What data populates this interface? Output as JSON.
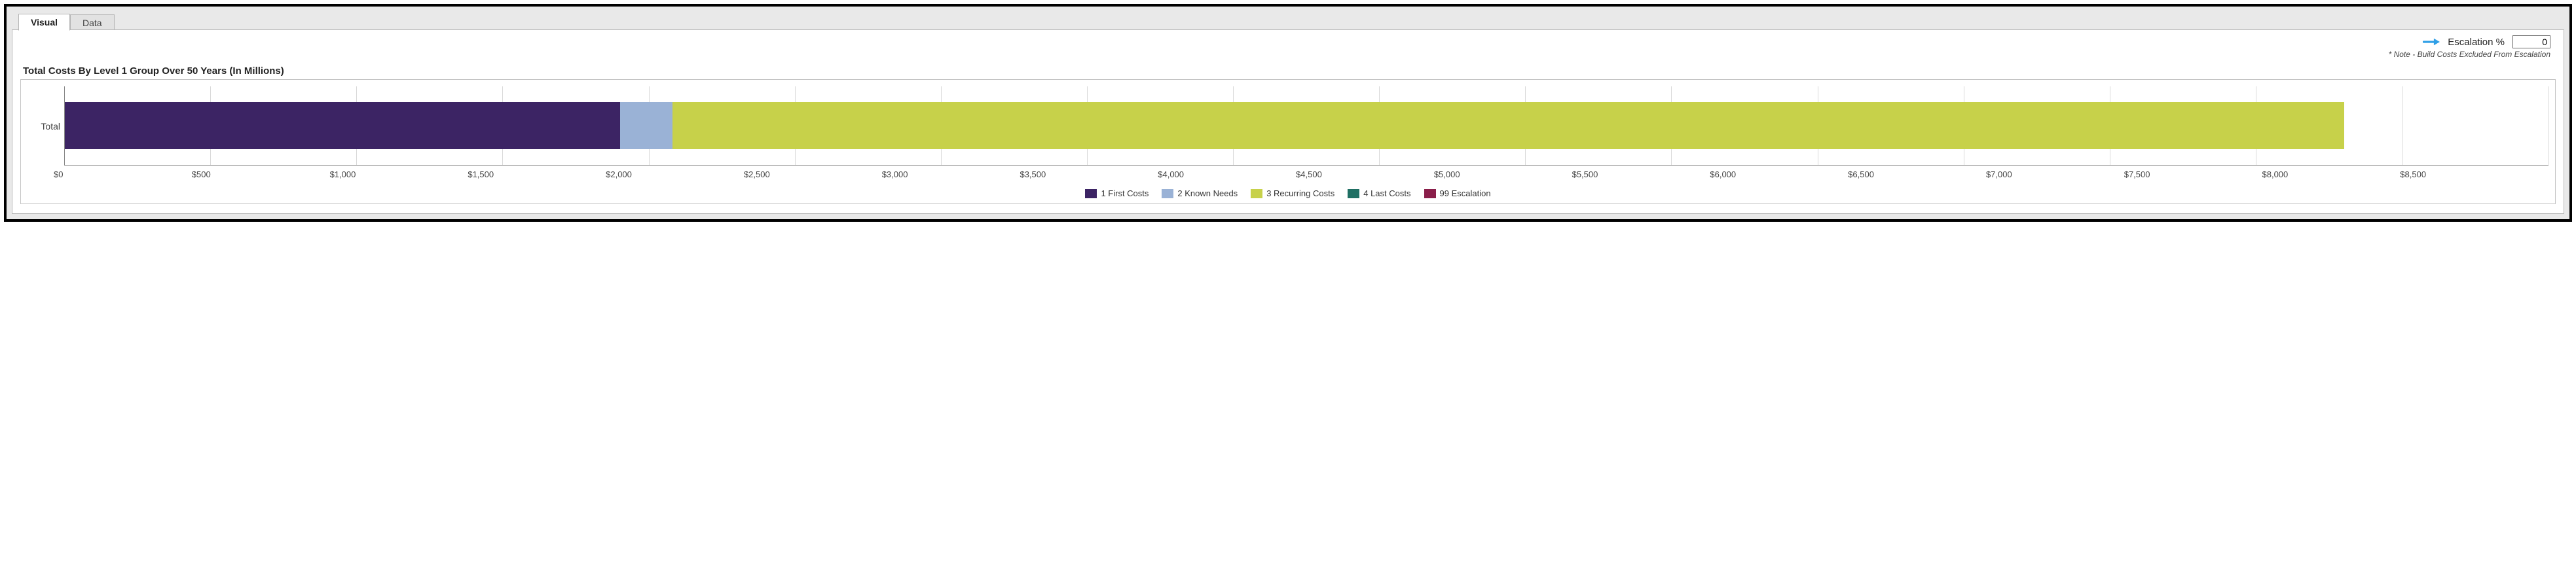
{
  "tabs": {
    "visual": "Visual",
    "data": "Data"
  },
  "header": {
    "escalation_label": "Escalation %",
    "escalation_value": "0",
    "note": "* Note - Build Costs Excluded From Escalation"
  },
  "chart_title": "Total Costs By Level 1 Group Over 50 Years (In Millions)",
  "legend": {
    "first_costs": "1 First Costs",
    "known_needs": "2 Known Needs",
    "recurring_costs": "3 Recurring Costs",
    "last_costs": "4 Last Costs",
    "escalation": "99 Escalation"
  },
  "colors": {
    "first_costs": "#3c2464",
    "known_needs": "#9ab2d6",
    "recurring_costs": "#c7d14a",
    "last_costs": "#1f6f63",
    "escalation": "#8a1e4a",
    "arrow": "#2f9fe6"
  },
  "x_ticks": [
    "$0",
    "$500",
    "$1,000",
    "$1,500",
    "$2,000",
    "$2,500",
    "$3,000",
    "$3,500",
    "$4,000",
    "$4,500",
    "$5,000",
    "$5,500",
    "$6,000",
    "$6,500",
    "$7,000",
    "$7,500",
    "$8,000",
    "$8,500"
  ],
  "y_category": "Total",
  "chart_data": {
    "type": "bar",
    "orientation": "horizontal",
    "stacked": true,
    "title": "Total Costs By Level 1 Group Over 50 Years (In Millions)",
    "xlabel": "",
    "ylabel": "",
    "xlim": [
      0,
      8500
    ],
    "x_ticks": [
      0,
      500,
      1000,
      1500,
      2000,
      2500,
      3000,
      3500,
      4000,
      4500,
      5000,
      5500,
      6000,
      6500,
      7000,
      7500,
      8000,
      8500
    ],
    "categories": [
      "Total"
    ],
    "series": [
      {
        "name": "1 First Costs",
        "color": "#3c2464",
        "values": [
          1900
        ]
      },
      {
        "name": "2 Known Needs",
        "color": "#9ab2d6",
        "values": [
          180
        ]
      },
      {
        "name": "3 Recurring Costs",
        "color": "#c7d14a",
        "values": [
          5720
        ]
      },
      {
        "name": "4 Last Costs",
        "color": "#1f6f63",
        "values": [
          0
        ]
      },
      {
        "name": "99 Escalation",
        "color": "#8a1e4a",
        "values": [
          0
        ]
      }
    ],
    "legend_position": "bottom",
    "grid": true
  }
}
